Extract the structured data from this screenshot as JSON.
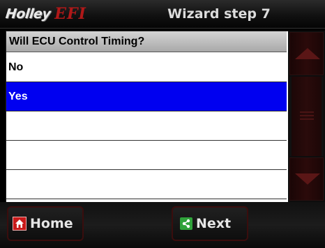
{
  "header": {
    "brand_holley": "Holley",
    "brand_efi": "EFI",
    "title": "Wizard step 7"
  },
  "list": {
    "question": "Will ECU Control Timing?",
    "options": [
      "No",
      "Yes",
      "",
      "",
      ""
    ],
    "selected_index": 1
  },
  "footer": {
    "home_label": "Home",
    "next_label": "Next"
  },
  "icons": {
    "home": "home-icon",
    "next": "share-icon",
    "scroll_up": "triangle-up-icon",
    "scroll_down": "triangle-down-icon"
  },
  "colors": {
    "selected_row": "#0000f0",
    "accent_red": "#b01818",
    "next_icon_green": "#2fa23a"
  }
}
